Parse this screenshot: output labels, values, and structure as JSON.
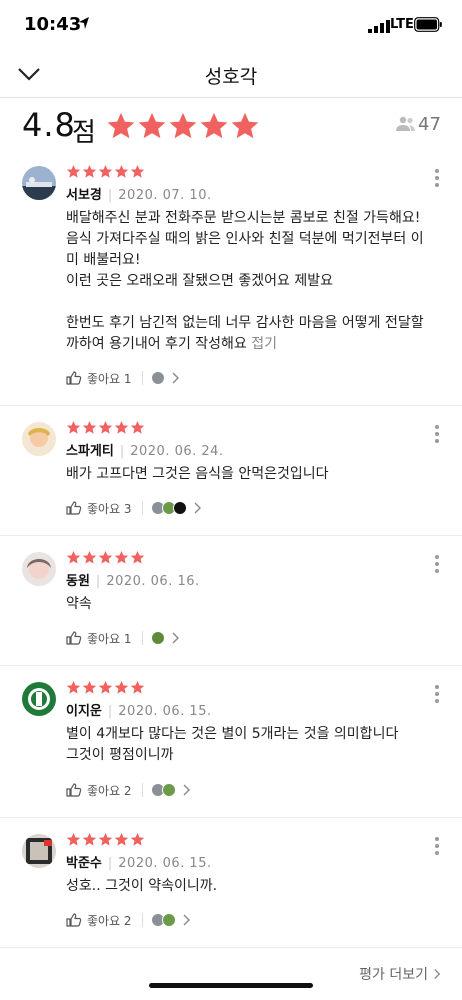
{
  "status_bar": {
    "time": "10:43",
    "network": "LTE"
  },
  "header": {
    "title": "성호각"
  },
  "summary": {
    "score": "4.8",
    "unit": "점",
    "stars": 5,
    "review_count": "47"
  },
  "colors": {
    "star": "#f0625f",
    "text": "#222222",
    "muted": "#888888"
  },
  "reviews": [
    {
      "name": "서보경",
      "date": "2020. 07. 10.",
      "rating": 5,
      "lines": [
        "배달해주신 분과 전화주문 받으시는분 콤보로 친절 가득해요!",
        "음식 가져다주실 때의 밝은 인사와 친절 덕분에 먹기전부터 이",
        "미 배불러요!",
        "이런 곳은 오래오래 잘됐으면 좋겠어요 제발요"
      ],
      "lines2": [
        "한번도 후기 남긴적 없는데 너무 감사한 마음을 어떻게 전달할",
        "까하여 용기내어 후기 작성해요"
      ],
      "fold": "접기",
      "like_label": "좋아요 1"
    },
    {
      "name": "스파게티",
      "date": "2020. 06. 24.",
      "rating": 5,
      "lines": [
        "배가 고프다면 그것은 음식을 안먹은것입니다"
      ],
      "like_label": "좋아요 3"
    },
    {
      "name": "동원",
      "date": "2020. 06. 16.",
      "rating": 5,
      "lines": [
        "약속"
      ],
      "like_label": "좋아요 1"
    },
    {
      "name": "이지운",
      "date": "2020. 06. 15.",
      "rating": 5,
      "lines": [
        "별이 4개보다 많다는 것은 별이 5개라는 것을 의미합니다",
        "그것이 평점이니까"
      ],
      "like_label": "좋아요 2"
    },
    {
      "name": "박준수",
      "date": "2020. 06. 15.",
      "rating": 5,
      "lines": [
        "성호.. 그것이 약속이니까."
      ],
      "like_label": "좋아요 2"
    }
  ],
  "footer": {
    "more_label": "평가 더보기"
  }
}
